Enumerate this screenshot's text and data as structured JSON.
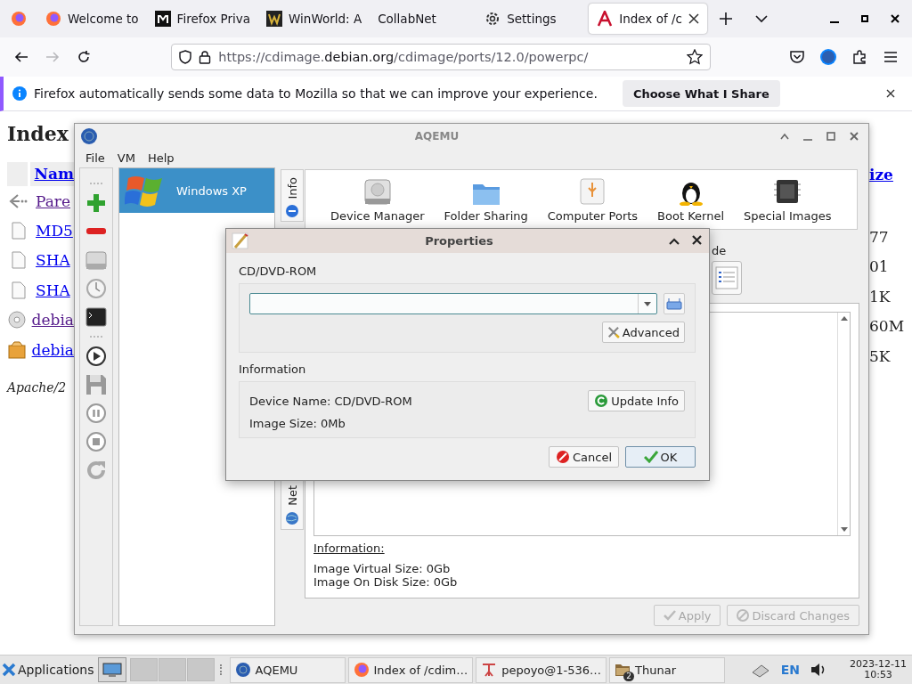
{
  "browser": {
    "tabs": [
      {
        "kind": "pinned",
        "selected": false
      },
      {
        "kind": "tab",
        "label": "Welcome to",
        "selected": false
      },
      {
        "kind": "tab",
        "label": "Firefox Priva",
        "selected": false
      },
      {
        "kind": "tab",
        "label": "WinWorld: A",
        "selected": false
      },
      {
        "kind": "tab",
        "label": "CollabNet",
        "selected": false
      },
      {
        "kind": "tab",
        "label": "Settings",
        "selected": false
      },
      {
        "kind": "tab",
        "label": "Index of /c",
        "selected": true
      }
    ],
    "nav_buttons": [
      {
        "kind": "back",
        "disabled": false
      },
      {
        "kind": "forward",
        "disabled": true
      },
      {
        "kind": "reload",
        "disabled": false
      }
    ],
    "url": {
      "start": "https://cdimage.",
      "domain": "debian.org",
      "path": "/cdimage/ports/12.0/powerpc/"
    },
    "notification": {
      "text": "Firefox automatically sends some data to Mozilla so that we can improve your experience.",
      "button": "Choose What I Share"
    }
  },
  "page": {
    "heading": "Index",
    "name_header": "Nam",
    "size_header": "ize",
    "rows": [
      {
        "kind": "parent",
        "name": "Pare",
        "visited": true
      },
      {
        "kind": "file",
        "name": "MD5",
        "visited": false,
        "size": "77"
      },
      {
        "kind": "file",
        "name": "SHA",
        "visited": false,
        "size": "01"
      },
      {
        "kind": "file",
        "name": "SHA",
        "visited": false,
        "size": "1K"
      },
      {
        "kind": "disc",
        "name": "debia",
        "visited": true,
        "size": "60M"
      },
      {
        "kind": "package",
        "name": "debia",
        "visited": false,
        "size": "5K"
      }
    ],
    "footer": "Apache/2"
  },
  "aqemu": {
    "title": "AQEMU",
    "menu": [
      "File",
      "VM",
      "Help"
    ],
    "vms": [
      {
        "name": "Windows XP",
        "selected": true
      }
    ],
    "side_tabs": [
      "Info",
      "Net"
    ],
    "sections": [
      "Device Manager",
      "Folder Sharing",
      "Computer Ports",
      "Boot Kernel",
      "Special Images"
    ],
    "partial_label": "de",
    "info_heading": "Information:",
    "info_lines": [
      "Image Virtual Size: 0Gb",
      "Image On Disk Size: 0Gb"
    ],
    "buttons": [
      {
        "label": "Apply",
        "disabled": true
      },
      {
        "label": "Discard Changes",
        "disabled": true
      }
    ]
  },
  "dialog": {
    "title": "Properties",
    "device_label": "CD/DVD-ROM",
    "advanced": "Advanced",
    "info_label": "Information",
    "device_name": "Device Name: CD/DVD-ROM",
    "image_size": "Image Size: 0Mb",
    "update": "Update Info",
    "cancel": "Cancel",
    "ok": "OK"
  },
  "taskbar": {
    "menu": "Applications",
    "tasks": [
      {
        "label": "AQEMU"
      },
      {
        "label": "Index of /cdim…"
      },
      {
        "label": "pepoyo@1-536…"
      },
      {
        "label": "Thunar",
        "badge": "2"
      }
    ],
    "layout": "EN",
    "date": "2023-12-11",
    "time": "10:53"
  }
}
